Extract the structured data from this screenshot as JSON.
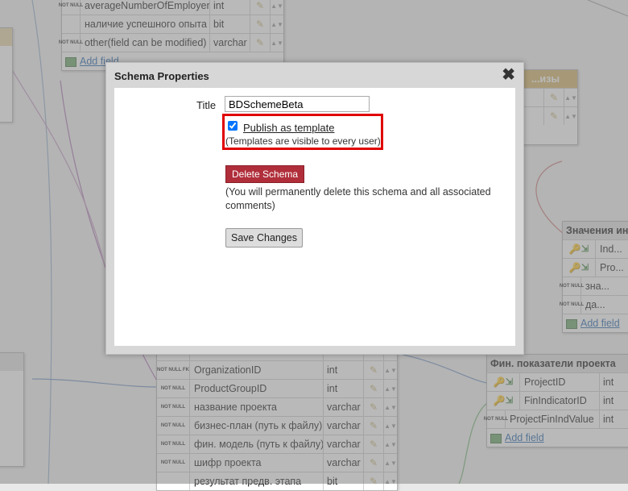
{
  "dialog": {
    "title": "Schema Properties",
    "close_icon": "close-icon",
    "title_label": "Title",
    "title_value": "BDSchemeBeta",
    "publish_checked": true,
    "publish_label": "Publish as template",
    "publish_hint": "(Templates are visible to every user)",
    "delete_button": "Delete Schema",
    "delete_hint": "(You will permanently delete this schema and all associated comments)",
    "save_button": "Save Changes"
  },
  "background_tables": {
    "top_table": {
      "rows": [
        {
          "key": "NOT NULL",
          "name": "averageNumberOfEmployers",
          "type": "int"
        },
        {
          "key": "",
          "name": "наличие успешного опыта",
          "type": "bit"
        },
        {
          "key": "NOT NULL",
          "name": "other(field can be modified)",
          "type": "varchar"
        }
      ],
      "add_field": "Add field"
    },
    "right_top_table": {
      "header": "...изы",
      "rows": [
        {
          "name": ""
        },
        {
          "name": ""
        }
      ]
    },
    "values_table": {
      "header": "Значения ин...",
      "rows": [
        {
          "key": "PK FK",
          "name": "Ind..."
        },
        {
          "key": "PK FK",
          "name": "Pro..."
        },
        {
          "key": "NOT NULL",
          "name": "зна..."
        },
        {
          "key": "NOT NULL",
          "name": "да..."
        }
      ],
      "add_field": "Add field"
    },
    "project_table": {
      "rows": [
        {
          "key": "NOT NULL FK",
          "name": "OrganizationID",
          "type": "int"
        },
        {
          "key": "NOT NULL",
          "name": "ProductGroupID",
          "type": "int"
        },
        {
          "key": "NOT NULL",
          "name": "название проекта",
          "type": "varchar"
        },
        {
          "key": "NOT NULL",
          "name": "бизнес-план (путь к файлу)",
          "type": "varchar"
        },
        {
          "key": "NOT NULL",
          "name": "фин. модель (путь к файлу)",
          "type": "varchar"
        },
        {
          "key": "NOT NULL",
          "name": "шифр проекта",
          "type": "varchar"
        },
        {
          "key": "",
          "name": "результат предв. этапа",
          "type": "bit"
        }
      ]
    },
    "fin_table": {
      "header": "Фин. показатели проекта",
      "rows": [
        {
          "key": "PK FK",
          "name": "ProjectID",
          "type": "int"
        },
        {
          "key": "PK FK",
          "name": "FinIndicatorID",
          "type": "int"
        },
        {
          "key": "NOT NULL",
          "name": "ProjectFinIndValue",
          "type": "int"
        }
      ],
      "add_field": "Add field"
    }
  }
}
